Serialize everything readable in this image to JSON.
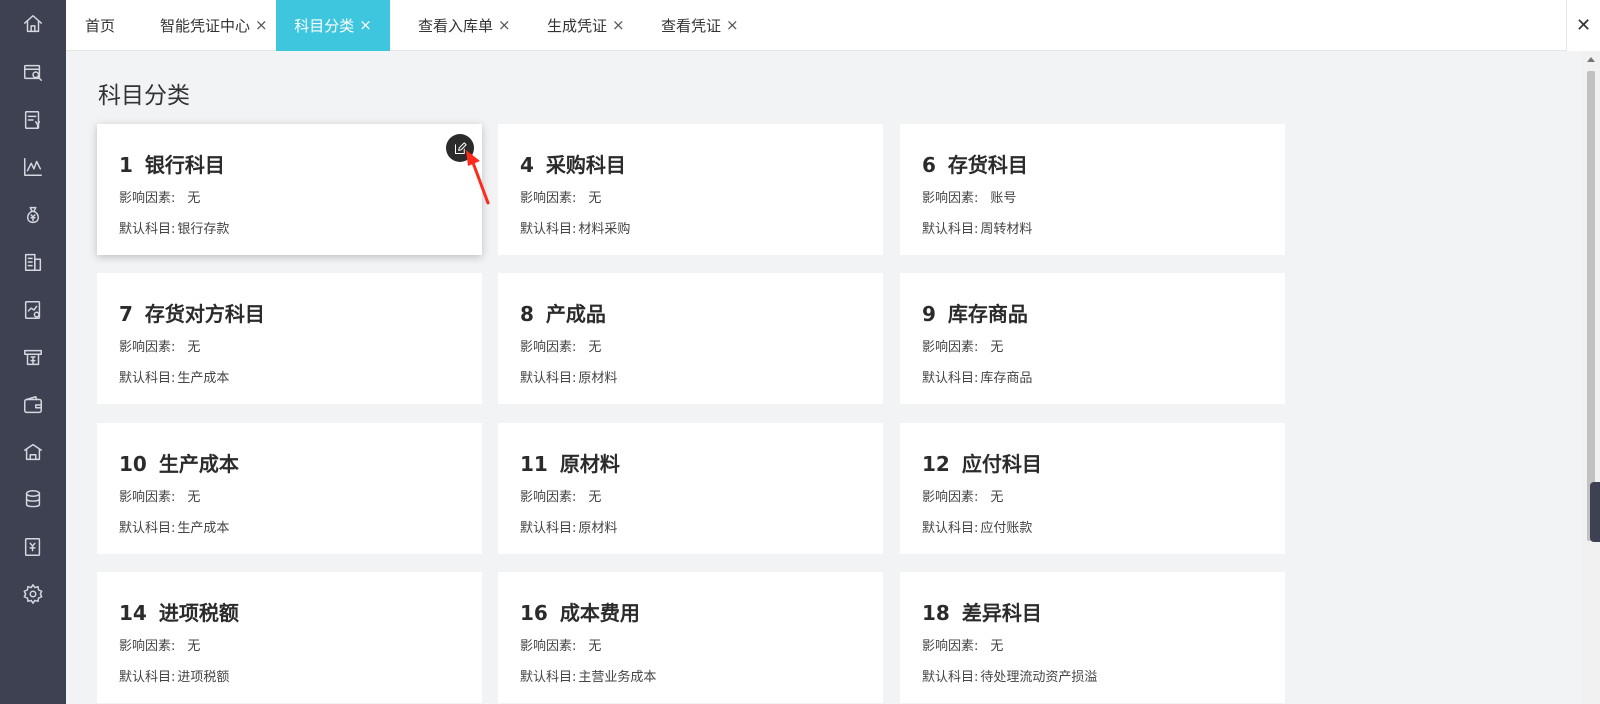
{
  "sidebar": {
    "icons": [
      "home-icon",
      "search-list-icon",
      "invoice-icon",
      "chart-icon",
      "money-bag-icon",
      "building-icon",
      "report-icon",
      "archive-icon",
      "wallet-icon",
      "warehouse-icon",
      "database-icon",
      "voucher-icon",
      "settings-icon"
    ]
  },
  "tabs": [
    {
      "label": "首页",
      "closable": false,
      "active": false
    },
    {
      "label": "智能凭证中心",
      "closable": true,
      "active": false
    },
    {
      "label": "科目分类",
      "closable": true,
      "active": true
    },
    {
      "label": "查看入库单",
      "closable": true,
      "active": false
    },
    {
      "label": "生成凭证",
      "closable": true,
      "active": false
    },
    {
      "label": "查看凭证",
      "closable": true,
      "active": false
    }
  ],
  "close_glyph": "×",
  "close_all_glyph": "✕",
  "page_title": "科目分类",
  "factor_label": "影响因素:",
  "default_label": "默认科目:",
  "cards": [
    {
      "num": "1",
      "name": "银行科目",
      "factor": "无",
      "default": "银行存款"
    },
    {
      "num": "4",
      "name": "采购科目",
      "factor": "无",
      "default": "材料采购"
    },
    {
      "num": "6",
      "name": "存货科目",
      "factor": "账号",
      "default": "周转材料"
    },
    {
      "num": "7",
      "name": "存货对方科目",
      "factor": "无",
      "default": "生产成本"
    },
    {
      "num": "8",
      "name": "产成品",
      "factor": "无",
      "default": "原材料"
    },
    {
      "num": "9",
      "name": "库存商品",
      "factor": "无",
      "default": "库存商品"
    },
    {
      "num": "10",
      "name": "生产成本",
      "factor": "无",
      "default": "生产成本"
    },
    {
      "num": "11",
      "name": "原材料",
      "factor": "无",
      "default": "原材料"
    },
    {
      "num": "12",
      "name": "应付科目",
      "factor": "无",
      "default": "应付账款"
    },
    {
      "num": "14",
      "name": "进项税额",
      "factor": "无",
      "default": "进项税额"
    },
    {
      "num": "16",
      "name": "成本费用",
      "factor": "无",
      "default": "主营业务成本"
    },
    {
      "num": "18",
      "name": "差异科目",
      "factor": "无",
      "default": "待处理流动资产损溢"
    }
  ],
  "colors": {
    "sidebar_bg": "#3e4152",
    "active_tab": "#3ec6de",
    "annotation_arrow": "#ff2a1a"
  }
}
